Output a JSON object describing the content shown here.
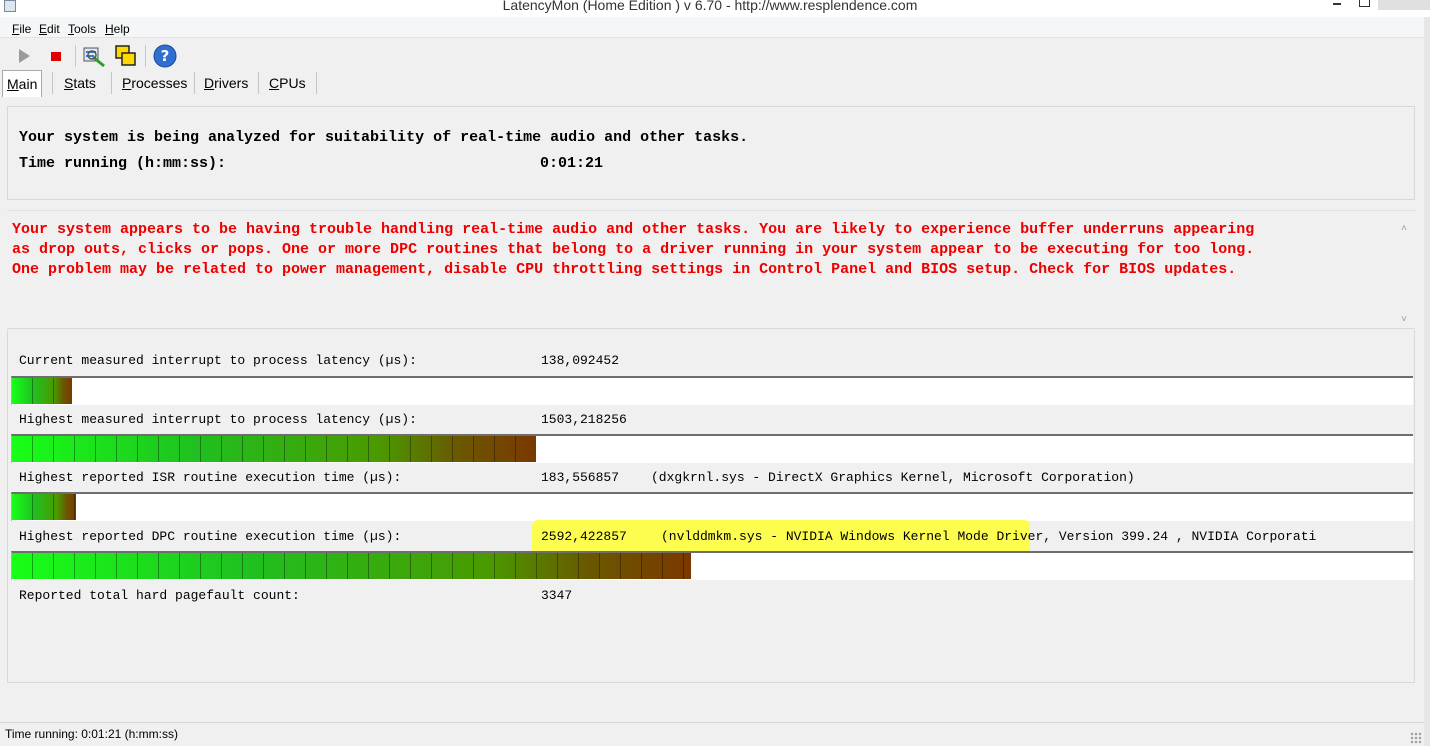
{
  "window": {
    "title": "LatencyMon  (Home Edition )  v 6.70 - http://www.resplendence.com"
  },
  "menu": [
    {
      "label": "File",
      "underline": "F",
      "rest": "ile"
    },
    {
      "label": "Edit",
      "underline": "E",
      "rest": "dit"
    },
    {
      "label": "Tools",
      "underline": "T",
      "rest": "ools"
    },
    {
      "label": "Help",
      "underline": "H",
      "rest": "elp"
    }
  ],
  "toolbar": {
    "icons": [
      "play-icon",
      "stop-icon",
      "analyze-icon",
      "windows-icon",
      "help-icon"
    ]
  },
  "tabs": [
    {
      "underline": "M",
      "rest": "ain",
      "active": true
    },
    {
      "underline": "S",
      "rest": "tats",
      "active": false
    },
    {
      "underline": "P",
      "rest": "rocesses",
      "active": false
    },
    {
      "underline": "D",
      "rest": "rivers",
      "active": false
    },
    {
      "underline": "C",
      "rest": "PUs",
      "active": false
    }
  ],
  "main": {
    "analysis_line": "Your system is being analyzed for suitability of real-time audio and other tasks.",
    "time_label": "Time running (h:mm:ss):",
    "time_value": "0:01:21",
    "warning": "Your system appears to be having trouble handling real-time audio and other tasks. You are likely to experience buffer underruns appearing\nas drop outs, clicks or pops. One or more DPC routines that belong to a driver running in your system appear to be executing for too long.\nOne problem may be related to power management, disable CPU throttling settings in Control Panel and BIOS setup. Check for BIOS updates."
  },
  "metrics": {
    "current_latency": {
      "label": "Current measured interrupt to process latency (µs):",
      "value": "138,092452",
      "level": 0.043
    },
    "highest_latency": {
      "label": "Highest measured interrupt to process latency (µs):",
      "value": "1503,218256",
      "level": 0.374
    },
    "highest_isr": {
      "label": "Highest reported ISR routine execution time (µs):",
      "value": "183,556857",
      "detail": "(dxgkrnl.sys - DirectX Graphics Kernel, Microsoft Corporation)",
      "level": 0.046
    },
    "highest_dpc": {
      "label": "Highest reported DPC routine execution time (µs):",
      "value": "2592,422857",
      "detail": "(nvlddmkm.sys - NVIDIA Windows Kernel Mode Driver, Version 399.24 , NVIDIA Corporati",
      "level": 0.485
    },
    "pagefault": {
      "label": "Reported total hard pagefault count:",
      "value": "3347"
    }
  },
  "status": {
    "text": "Time running: 0:01:21  (h:mm:ss)"
  }
}
